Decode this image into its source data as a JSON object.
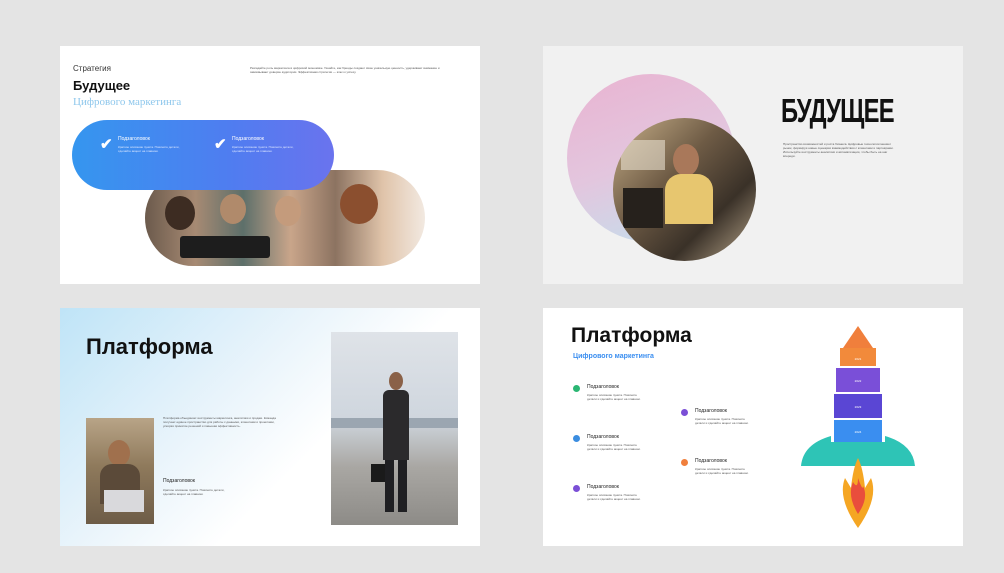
{
  "slide1": {
    "kicker": "Стратегия",
    "title": "Будущее",
    "subtitle": "Цифрового маркетинга",
    "body": "Разгадайте роль маркетинга в цифровой экономике. Узнайте, как бренды создают свою уникальную ценность, удерживают внимание и завоёвывают доверие аудитории. Эффективная стратегия — ключ к успеху.",
    "items": [
      {
        "label": "Подзаголовок",
        "text": "Краткое описание пункта. Поясните детали, сделайте акцент на главном."
      },
      {
        "label": "Подзаголовок",
        "text": "Краткое описание пункта. Поясните детали, сделайте акцент на главном."
      }
    ]
  },
  "slide2": {
    "title": "БУДУЩЕЕ",
    "body": "Пространство возможностей и роста бизнеса. Цифровые технологии меняют рынок, формируя новые сценарии взаимодействия с клиентами и партнёрами. Используйте инструменты аналитики и автоматизации, чтобы быть на шаг впереди."
  },
  "slide3": {
    "title": "Платформа",
    "body": "Платформа объединяет инструменты маркетинга, аналитики и продаж. Команда получает единое пространство для работы с данными, клиентами и проектами, ускоряя принятие решений и повышая эффективность.",
    "sub_label": "Подзаголовок",
    "sub_text": "Краткое описание пункта. Поясните детали, сделайте акцент на главном."
  },
  "slide4": {
    "title": "Платформа",
    "subtitle": "Цифрового маркетинга",
    "items_left": [
      {
        "label": "Подзаголовок",
        "text": "Краткое описание пункта. Поясните детали и сделайте акцент на главном.",
        "color": "#2bb673"
      },
      {
        "label": "Подзаголовок",
        "text": "Краткое описание пункта. Поясните детали и сделайте акцент на главном.",
        "color": "#3b8de0"
      },
      {
        "label": "Подзаголовок",
        "text": "Краткое описание пункта. Поясните детали и сделайте акцент на главном.",
        "color": "#7b4fd6"
      }
    ],
    "items_right": [
      {
        "label": "Подзаголовок",
        "text": "Краткое описание пункта. Поясните детали и сделайте акцент на главном.",
        "color": "#7b4fd6"
      },
      {
        "label": "Подзаголовок",
        "text": "Краткое описание пункта. Поясните детали и сделайте акцент на главном.",
        "color": "#f07f3c"
      }
    ],
    "rocket_labels": [
      "2021",
      "2022",
      "2023",
      "2024"
    ]
  },
  "colors": {
    "blue": "#3a8ef0",
    "light_blue": "#8fc6ee",
    "purple": "#6a40d8",
    "green": "#2bb673",
    "orange": "#f07f3c",
    "pink": "#e7b5d6"
  }
}
